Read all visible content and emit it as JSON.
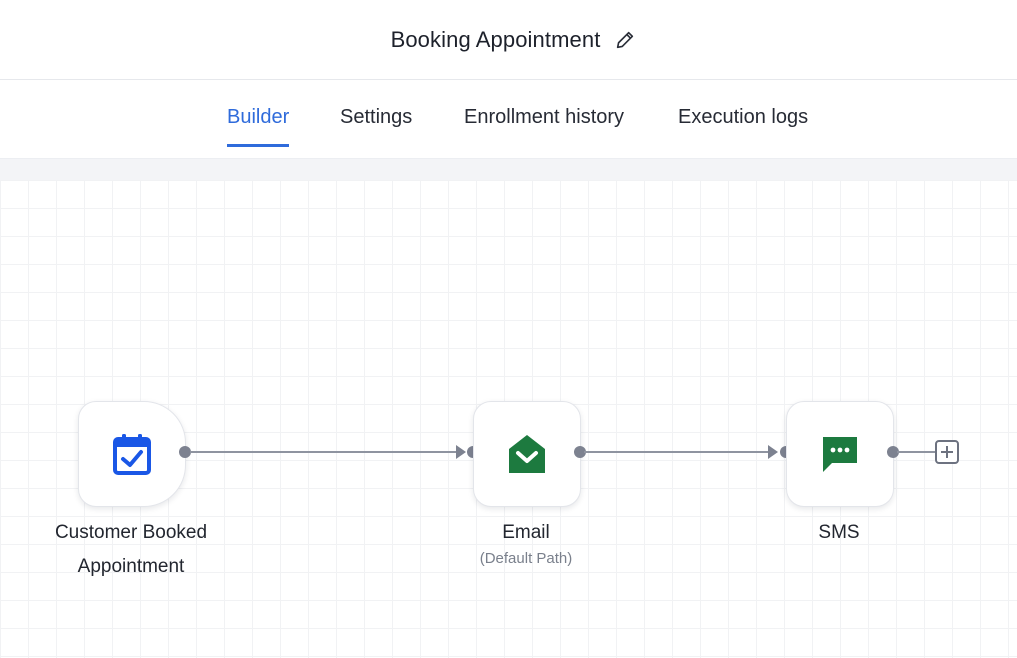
{
  "header": {
    "title": "Booking Appointment"
  },
  "tabs": [
    {
      "label": "Builder",
      "active": true
    },
    {
      "label": "Settings",
      "active": false
    },
    {
      "label": "Enrollment history",
      "active": false
    },
    {
      "label": "Execution logs",
      "active": false
    }
  ],
  "workflow": {
    "nodes": [
      {
        "label_line1": "Customer Booked",
        "label_line2": "Appointment",
        "icon": "calendar-check-icon",
        "color": "#1a57e6"
      },
      {
        "label": "Email",
        "sublabel": "(Default Path)",
        "icon": "envelope-icon",
        "color": "#1d7a3f"
      },
      {
        "label": "SMS",
        "icon": "chat-bubble-icon",
        "color": "#1d7a3f"
      }
    ],
    "add_step_icon": "plus-icon"
  },
  "colors": {
    "accent": "#2f6bdb",
    "connector": "#7d8290",
    "icon_green": "#1d7a3f",
    "icon_blue": "#1a57e6"
  }
}
